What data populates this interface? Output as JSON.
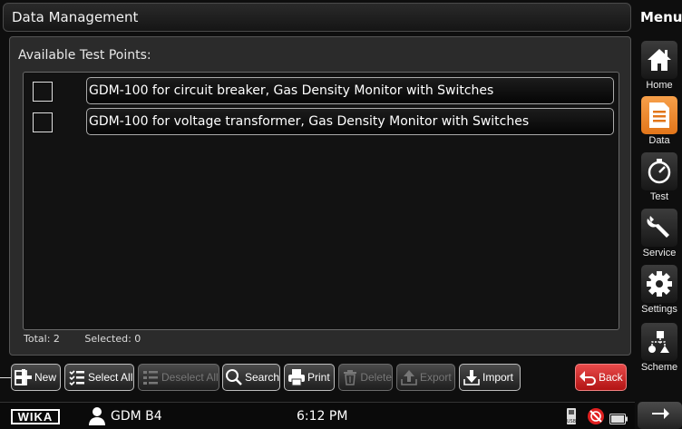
{
  "header": {
    "title": "Data Management"
  },
  "panel": {
    "label": "Available Test Points:",
    "items": [
      {
        "label": "GDM-100 for circuit breaker, Gas Density Monitor with Switches",
        "checked": false
      },
      {
        "label": "GDM-100 for voltage transformer, Gas Density Monitor with Switches",
        "checked": false
      }
    ],
    "total": "Total: 2",
    "selected": "Selected: 0"
  },
  "toolbar": {
    "new": "New",
    "select_all": "Select All",
    "deselect_all": "Deselect All",
    "search": "Search",
    "print": "Print",
    "delete": "Delete",
    "export": "Export",
    "import": "Import",
    "back": "Back"
  },
  "sidebar": {
    "title": "Menu",
    "items": [
      {
        "label": "Home",
        "icon": "home-icon",
        "active": false
      },
      {
        "label": "Data",
        "icon": "document-icon",
        "active": true
      },
      {
        "label": "Test",
        "icon": "gauge-icon",
        "active": false
      },
      {
        "label": "Service",
        "icon": "wrench-icon",
        "active": false
      },
      {
        "label": "Settings",
        "icon": "gear-icon",
        "active": false
      },
      {
        "label": "Scheme",
        "icon": "scheme-icon",
        "active": false
      }
    ]
  },
  "status": {
    "logo": "WIKA",
    "device": "GDM B4",
    "time": "6:12 PM",
    "icons": [
      "usb-icon",
      "no-connection-icon",
      "battery-icon"
    ]
  },
  "colors": {
    "accent": "#f08a24",
    "back": "#c81e1e",
    "background": "#0e0e0e"
  }
}
